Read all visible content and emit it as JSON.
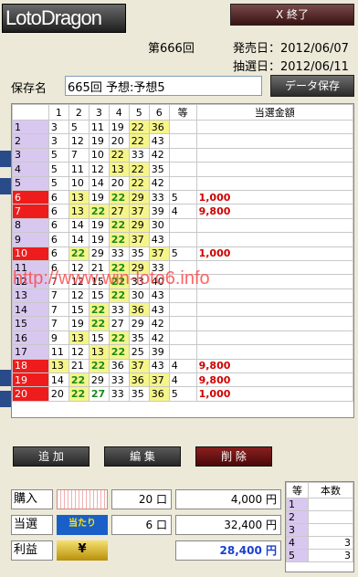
{
  "app": {
    "logo": "LotoDragon",
    "close_label": "X 終了"
  },
  "header": {
    "draw_no": "第666回",
    "sale_date": "発売日：2012/06/07",
    "draw_date": "抽選日：2012/06/11"
  },
  "save": {
    "label": "保存名",
    "value": "665回 予想:予想5",
    "button": "データ保存"
  },
  "grid": {
    "columns": [
      "",
      "1",
      "2",
      "3",
      "4",
      "5",
      "6",
      "等",
      "当選金額"
    ],
    "rows": [
      {
        "n": "1",
        "v": [
          "3",
          "5",
          "11",
          "19",
          "22",
          "36"
        ],
        "y": [
          4,
          5
        ],
        "g": [],
        "hit": false,
        "rank": "",
        "amt": ""
      },
      {
        "n": "2",
        "v": [
          "3",
          "12",
          "19",
          "20",
          "22",
          "43"
        ],
        "y": [
          4
        ],
        "g": [],
        "hit": false,
        "rank": "",
        "amt": ""
      },
      {
        "n": "3",
        "v": [
          "5",
          "7",
          "10",
          "22",
          "33",
          "42"
        ],
        "y": [
          3
        ],
        "g": [],
        "hit": false,
        "rank": "",
        "amt": ""
      },
      {
        "n": "4",
        "v": [
          "5",
          "11",
          "12",
          "13",
          "22",
          "35"
        ],
        "y": [
          3,
          4
        ],
        "g": [],
        "hit": false,
        "rank": "",
        "amt": ""
      },
      {
        "n": "5",
        "v": [
          "5",
          "10",
          "14",
          "20",
          "22",
          "42"
        ],
        "y": [
          4
        ],
        "g": [],
        "hit": false,
        "rank": "",
        "amt": ""
      },
      {
        "n": "6",
        "v": [
          "6",
          "13",
          "19",
          "22",
          "29",
          "33"
        ],
        "y": [
          1,
          3,
          4
        ],
        "g": [
          3
        ],
        "hit": true,
        "rank": "5",
        "amt": "1,000"
      },
      {
        "n": "7",
        "v": [
          "6",
          "13",
          "22",
          "27",
          "37",
          "39"
        ],
        "y": [
          1,
          2,
          3,
          4
        ],
        "g": [
          2
        ],
        "hit": true,
        "rank": "4",
        "amt": "9,800"
      },
      {
        "n": "8",
        "v": [
          "6",
          "14",
          "19",
          "22",
          "29",
          "30"
        ],
        "y": [
          3,
          4
        ],
        "g": [
          3
        ],
        "hit": false,
        "rank": "",
        "amt": ""
      },
      {
        "n": "9",
        "v": [
          "6",
          "14",
          "19",
          "22",
          "37",
          "43"
        ],
        "y": [
          3,
          4
        ],
        "g": [
          3
        ],
        "hit": false,
        "rank": "",
        "amt": ""
      },
      {
        "n": "10",
        "v": [
          "6",
          "22",
          "29",
          "33",
          "35",
          "37"
        ],
        "y": [
          1,
          5
        ],
        "g": [
          1
        ],
        "hit": true,
        "rank": "5",
        "amt": "1,000"
      },
      {
        "n": "11",
        "v": [
          "6",
          "12",
          "21",
          "22",
          "29",
          "33"
        ],
        "y": [
          3,
          4
        ],
        "g": [
          3
        ],
        "hit": false,
        "rank": "",
        "amt": ""
      },
      {
        "n": "12",
        "v": [
          "7",
          "12",
          "15",
          "22",
          "33",
          "40"
        ],
        "y": [
          3
        ],
        "g": [
          3
        ],
        "hit": false,
        "rank": "",
        "amt": ""
      },
      {
        "n": "13",
        "v": [
          "7",
          "12",
          "15",
          "22",
          "30",
          "43"
        ],
        "y": [
          3
        ],
        "g": [
          3
        ],
        "hit": false,
        "rank": "",
        "amt": ""
      },
      {
        "n": "14",
        "v": [
          "7",
          "15",
          "22",
          "33",
          "36",
          "43"
        ],
        "y": [
          2,
          4
        ],
        "g": [
          2
        ],
        "hit": false,
        "rank": "",
        "amt": ""
      },
      {
        "n": "15",
        "v": [
          "7",
          "19",
          "22",
          "27",
          "29",
          "42"
        ],
        "y": [
          2
        ],
        "g": [
          2
        ],
        "hit": false,
        "rank": "",
        "amt": ""
      },
      {
        "n": "16",
        "v": [
          "9",
          "13",
          "15",
          "22",
          "35",
          "42"
        ],
        "y": [
          1,
          3
        ],
        "g": [
          3
        ],
        "hit": false,
        "rank": "",
        "amt": ""
      },
      {
        "n": "17",
        "v": [
          "11",
          "12",
          "13",
          "22",
          "25",
          "39"
        ],
        "y": [
          2,
          3
        ],
        "g": [
          3
        ],
        "hit": false,
        "rank": "",
        "amt": ""
      },
      {
        "n": "18",
        "v": [
          "13",
          "21",
          "22",
          "36",
          "37",
          "43"
        ],
        "y": [
          0,
          2,
          4
        ],
        "g": [
          2
        ],
        "hit": true,
        "rank": "4",
        "amt": "9,800"
      },
      {
        "n": "19",
        "v": [
          "14",
          "22",
          "29",
          "33",
          "36",
          "37"
        ],
        "y": [
          1,
          4,
          5
        ],
        "g": [
          1
        ],
        "hit": true,
        "rank": "4",
        "amt": "9,800"
      },
      {
        "n": "20",
        "v": [
          "20",
          "22",
          "27",
          "33",
          "35",
          "36"
        ],
        "y": [
          1,
          5
        ],
        "g": [
          1,
          2
        ],
        "hit": true,
        "rank": "5",
        "amt": "1,000"
      }
    ]
  },
  "watermark": "http://www.win-loto6.info",
  "buttons": {
    "add": "追 加",
    "edit": "編 集",
    "delete": "削 除"
  },
  "summary": {
    "purchase": {
      "label": "購入",
      "count": "20 口",
      "yen": "4,000 円"
    },
    "win": {
      "label": "当選",
      "icon": "当たり",
      "count": "6 口",
      "yen": "32,400 円"
    },
    "profit": {
      "label": "利益",
      "icon": "¥",
      "yen": "28,400 円"
    }
  },
  "stats": {
    "headers": [
      "等",
      "本数"
    ],
    "rows": [
      {
        "k": "1",
        "v": ""
      },
      {
        "k": "2",
        "v": ""
      },
      {
        "k": "3",
        "v": ""
      },
      {
        "k": "4",
        "v": "3"
      },
      {
        "k": "5",
        "v": "3"
      }
    ]
  },
  "colors": {
    "hit": "#ee1c1c",
    "highlight": "#f5f58a",
    "rownum": "#d8c8f0"
  }
}
